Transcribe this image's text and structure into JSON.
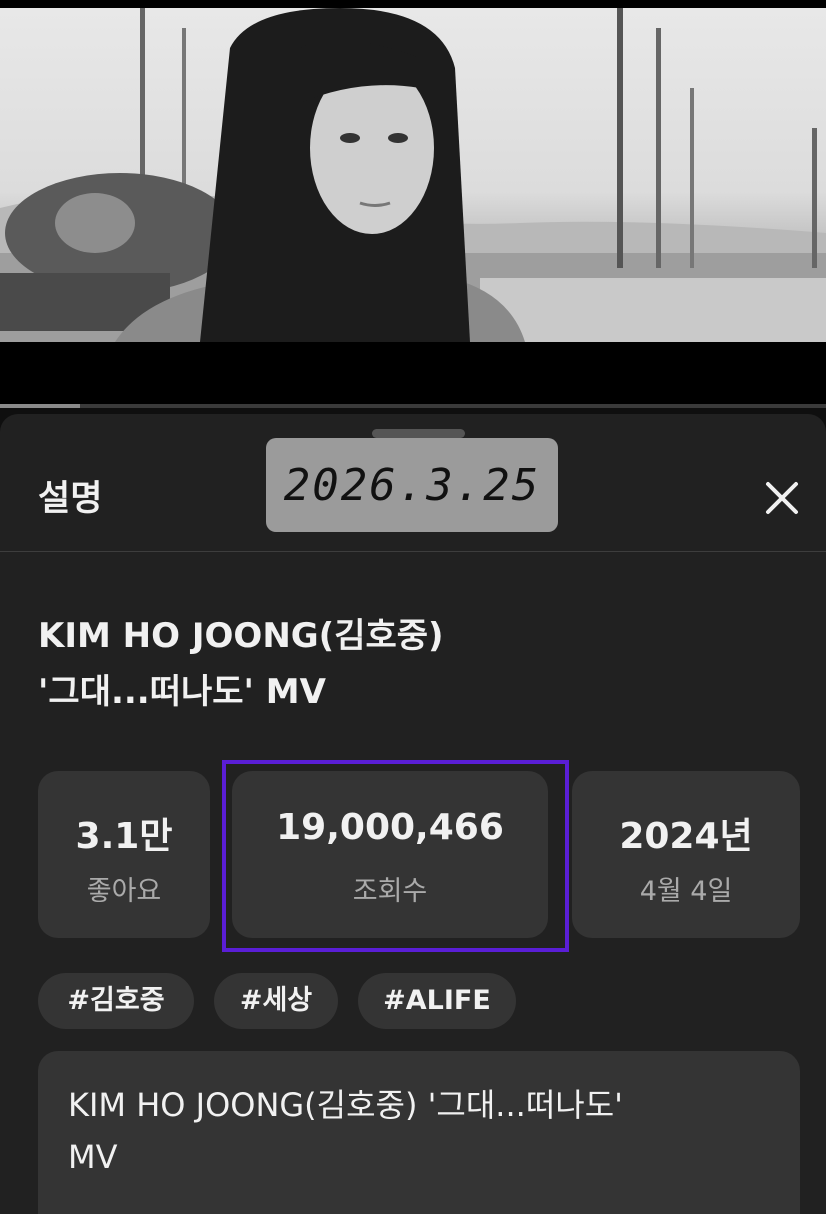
{
  "sheet": {
    "title": "설명",
    "handwritten_date": "2026.3.25",
    "close_icon": "close-icon"
  },
  "video": {
    "title_line1": "KIM HO JOONG(김호중)",
    "title_line2": "'그대...떠나도' MV",
    "progress": 0.097
  },
  "stats": {
    "likes": {
      "value": "3.1만",
      "label": "좋아요"
    },
    "views": {
      "value": "19,000,466",
      "label": "조회수"
    },
    "date": {
      "value": "2024년",
      "label": "4월 4일"
    }
  },
  "tags": [
    "#김호중",
    "#세상",
    "#ALIFE"
  ],
  "description": {
    "line1": "KIM HO JOONG(김호중) '그대...떠나도'",
    "line2": "MV"
  },
  "colors": {
    "background": "#0f0f0f",
    "sheet": "#212121",
    "card": "#343434",
    "highlight": "#5a1ed6"
  }
}
